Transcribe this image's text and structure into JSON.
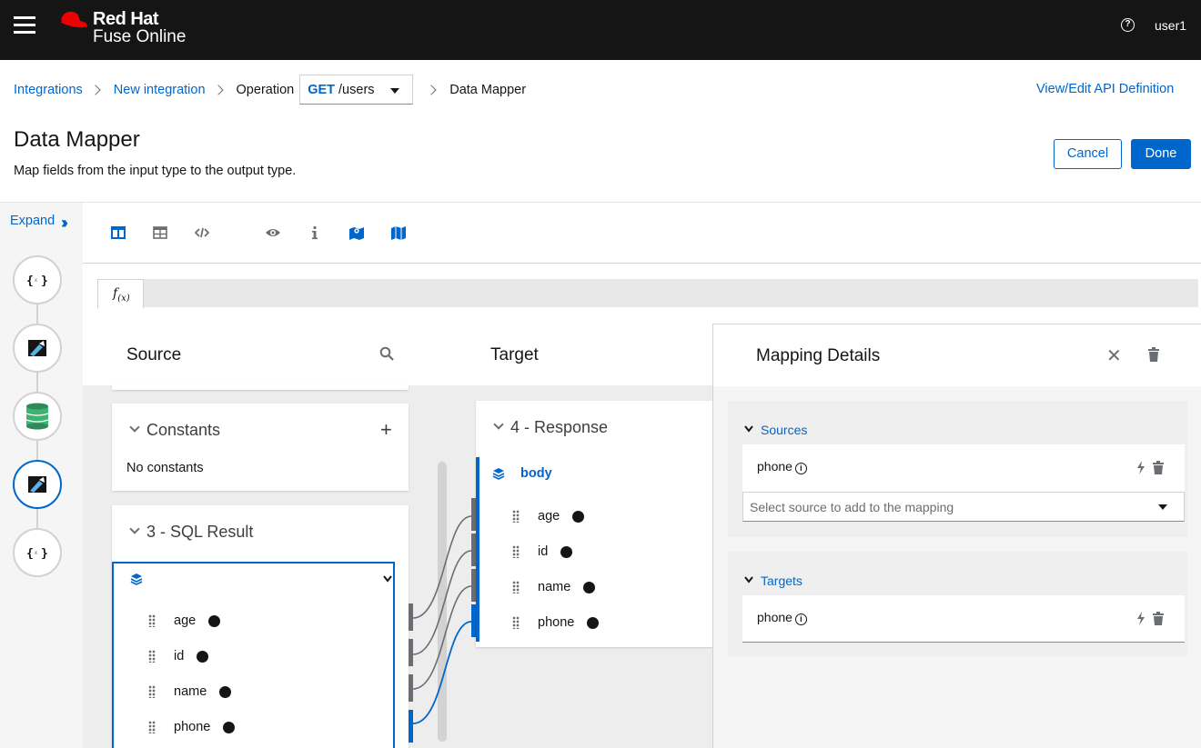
{
  "masthead": {
    "brand_line1": "Red Hat",
    "brand_line2": "Fuse Online",
    "help_icon": "?",
    "user": "user1"
  },
  "breadcrumb": {
    "items": [
      "Integrations",
      "New integration",
      "Operation"
    ],
    "operation_method": "GET",
    "operation_path": "/users",
    "current": "Data Mapper"
  },
  "api_link": "View/Edit API Definition",
  "page": {
    "title": "Data Mapper",
    "description": "Map fields from the input type to the output type.",
    "cancel": "Cancel",
    "done": "Done"
  },
  "rail": {
    "expand": "Expand",
    "steps": [
      "api-provider-start-icon",
      "data-mapper-icon",
      "database-icon",
      "data-mapper-icon",
      "api-provider-end-icon"
    ]
  },
  "toolbar": {
    "tools": [
      "column-mapper-icon",
      "table-icon",
      "code-icon",
      "eye-icon",
      "info-icon",
      "mapped-fields-icon",
      "unmapped-fields-icon"
    ]
  },
  "fx_tab": "f",
  "fx_sub": "(x)",
  "source": {
    "header": "Source",
    "constants": {
      "title": "Constants",
      "empty": "No constants"
    },
    "sql": {
      "title": "3 - SQL Result",
      "fields": [
        "age",
        "id",
        "name",
        "phone"
      ]
    }
  },
  "target": {
    "header": "Target",
    "response": {
      "title": "4 - Response",
      "body": "body",
      "fields": [
        "age",
        "id",
        "name",
        "phone"
      ]
    }
  },
  "details": {
    "title": "Mapping Details",
    "sources_label": "Sources",
    "source_field": "phone",
    "select_placeholder": "Select source to add to the mapping",
    "targets_label": "Targets",
    "target_field": "phone"
  },
  "colors": {
    "accent": "#0066cc",
    "masthead": "#151515",
    "brand_red": "#ee0000"
  }
}
